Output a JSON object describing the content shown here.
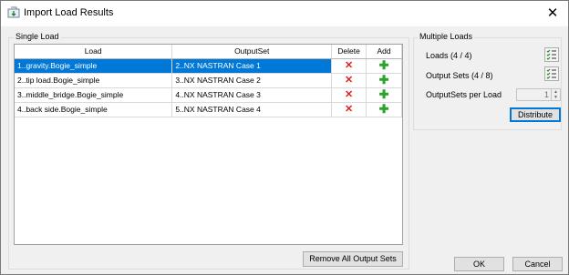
{
  "window": {
    "title": "Import Load Results",
    "close_glyph": "✕"
  },
  "single_load": {
    "group_label": "Single Load",
    "columns": [
      "Load",
      "OutputSet",
      "Delete",
      "Add"
    ],
    "rows": [
      {
        "load": "1..gravity.Bogie_simple",
        "output_set": "2..NX NASTRAN Case 1",
        "selected": true
      },
      {
        "load": "2..tip load.Bogie_simple",
        "output_set": "3..NX NASTRAN Case 2",
        "selected": false
      },
      {
        "load": "3..middle_bridge.Bogie_simple",
        "output_set": "4..NX NASTRAN Case 3",
        "selected": false
      },
      {
        "load": "4..back side.Bogie_simple",
        "output_set": "5..NX NASTRAN Case 4",
        "selected": false
      }
    ],
    "delete_glyph": "✕",
    "add_glyph": "✚",
    "remove_all_label": "Remove All Output Sets"
  },
  "multiple_loads": {
    "group_label": "Multiple Loads",
    "loads_label": "Loads (4 / 4)",
    "output_sets_label": "Output Sets (4 / 8)",
    "outputsets_per_load_label": "OutputSets per Load",
    "outputsets_per_load_value": "1",
    "distribute_label": "Distribute"
  },
  "footer": {
    "ok_label": "OK",
    "cancel_label": "Cancel"
  },
  "colors": {
    "selection": "#0078d7",
    "delete": "#e02020",
    "add": "#2aa52a"
  }
}
